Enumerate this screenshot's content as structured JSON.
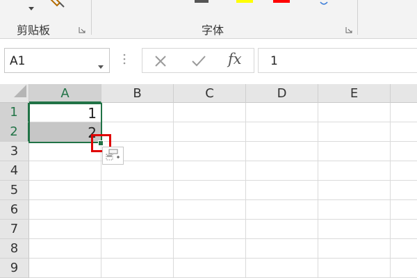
{
  "ribbon": {
    "clipboard_group_label": "剪贴板",
    "font_group_label": "字体",
    "colors": {
      "highlight": "#ffff00",
      "font_color": "#ff0000"
    }
  },
  "formula_bar": {
    "name_box_value": "A1",
    "fx_label": "fx",
    "formula_value": "1"
  },
  "grid": {
    "columns": [
      "A",
      "B",
      "C",
      "D",
      "E"
    ],
    "active_column": "A",
    "rows": [
      "1",
      "2",
      "3",
      "4",
      "5",
      "6",
      "7",
      "8",
      "9"
    ],
    "active_rows": [
      "1",
      "2"
    ],
    "cells": {
      "A1": "1",
      "A2": "2"
    }
  },
  "theme": {
    "accent": "#217346",
    "highlight_box": "#e00000"
  }
}
